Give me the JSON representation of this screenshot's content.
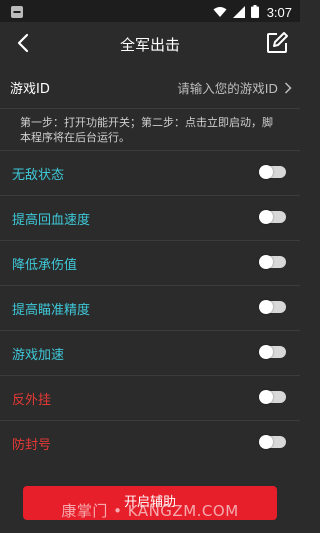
{
  "status": {
    "time": "3:07"
  },
  "header": {
    "title": "全军出击"
  },
  "game_id": {
    "label": "游戏ID",
    "placeholder": "请输入您的游戏ID"
  },
  "instruction": "第一步：打开功能开关；第二步：点击立即启动，脚本程序将在后台运行。",
  "features": [
    {
      "label": "无敌状态",
      "color": "#3ec8d8",
      "enabled": false
    },
    {
      "label": "提高回血速度",
      "color": "#3ec8d8",
      "enabled": false
    },
    {
      "label": "降低承伤值",
      "color": "#3ec8d8",
      "enabled": false
    },
    {
      "label": "提高瞄准精度",
      "color": "#3ec8d8",
      "enabled": false
    },
    {
      "label": "游戏加速",
      "color": "#3ec8d8",
      "enabled": false
    },
    {
      "label": "反外挂",
      "color": "#e53935",
      "enabled": false
    },
    {
      "label": "防封号",
      "color": "#e53935",
      "enabled": false
    }
  ],
  "start_button": {
    "label": "开启辅助"
  },
  "watermark": "康掌门 • KANGZM.COM"
}
